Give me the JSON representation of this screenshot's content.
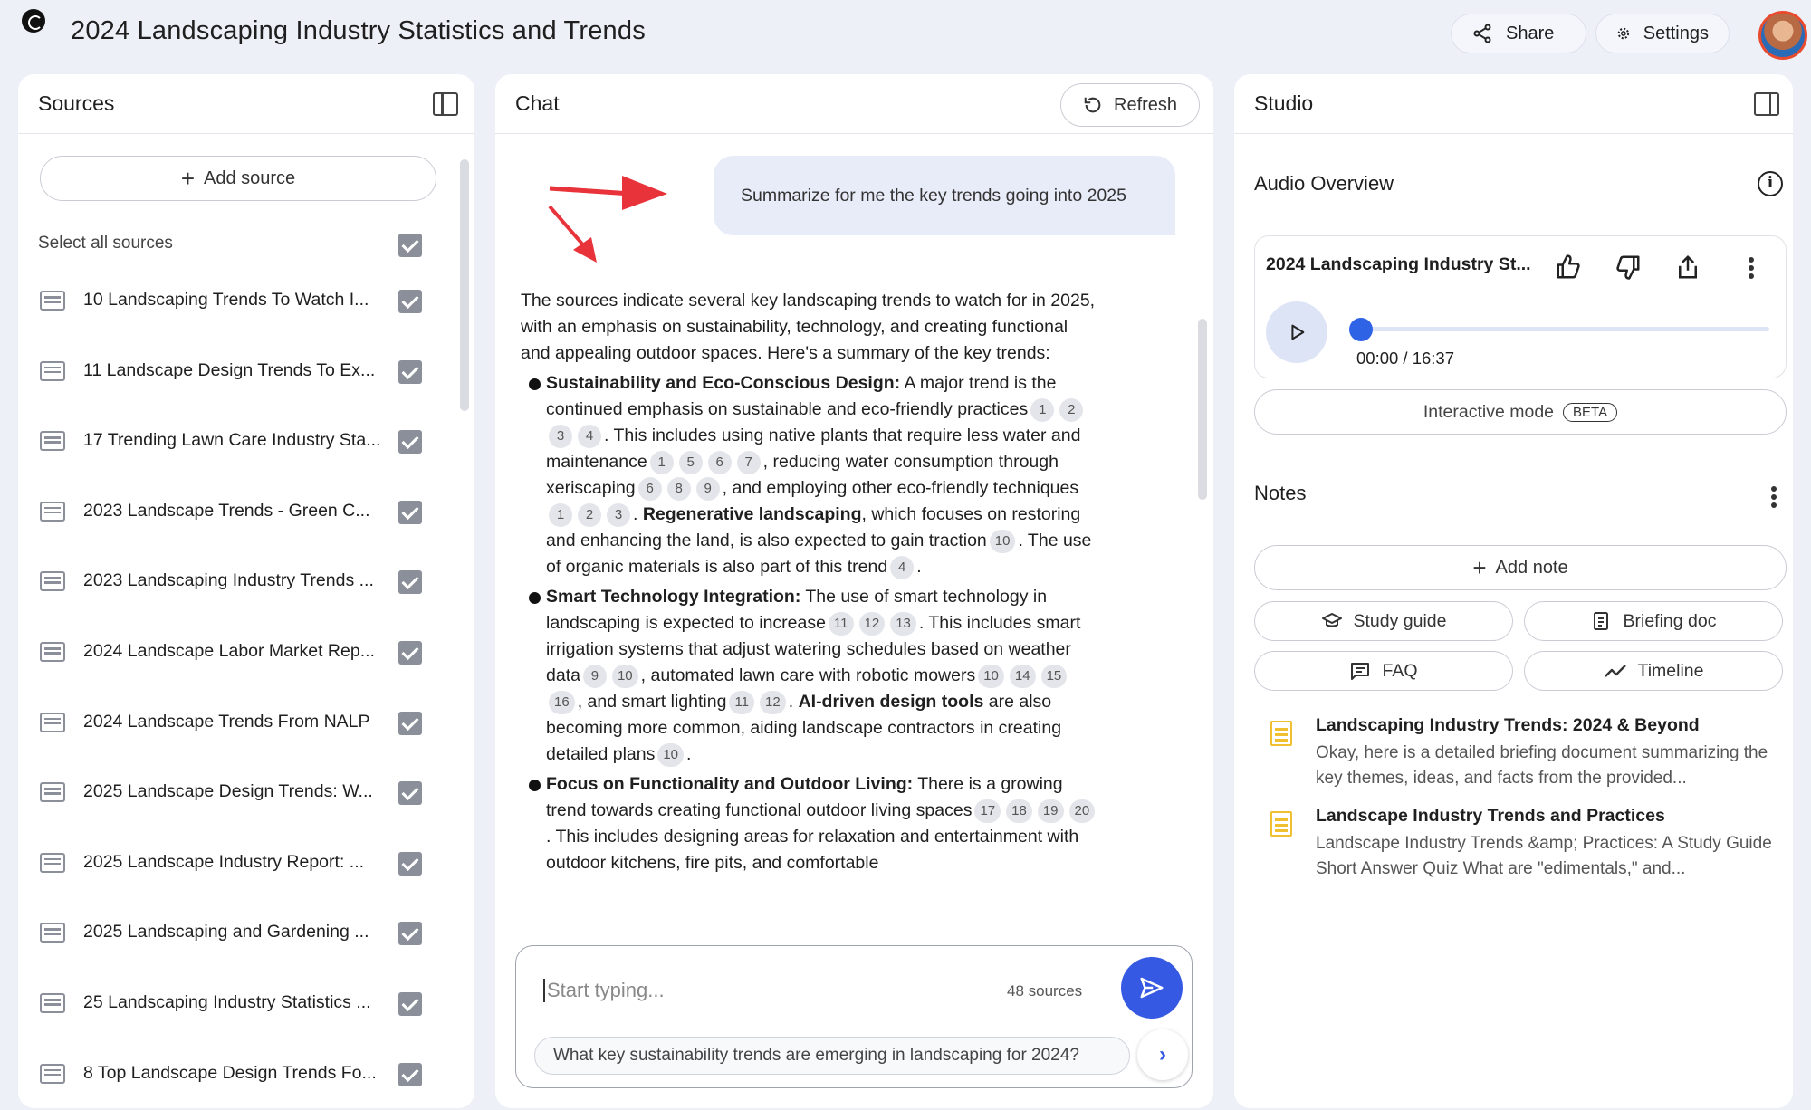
{
  "app": {
    "title": "2024 Landscaping Industry Statistics and Trends",
    "share_label": "Share",
    "settings_label": "Settings"
  },
  "sources": {
    "title": "Sources",
    "add_source_label": "Add source",
    "select_all_label": "Select all sources",
    "items": [
      {
        "label": "10 Landscaping Trends To Watch I...",
        "checked": true
      },
      {
        "label": "11 Landscape Design Trends To Ex...",
        "checked": true
      },
      {
        "label": "17 Trending Lawn Care Industry Sta...",
        "checked": true
      },
      {
        "label": "2023 Landscape Trends - Green C...",
        "checked": true
      },
      {
        "label": "2023 Landscaping Industry Trends ...",
        "checked": true
      },
      {
        "label": "2024 Landscape Labor Market Rep...",
        "checked": true
      },
      {
        "label": "2024 Landscape Trends From NALP",
        "checked": true
      },
      {
        "label": "2025 Landscape Design Trends: W...",
        "checked": true
      },
      {
        "label": "2025 Landscape Industry Report: ...",
        "checked": true
      },
      {
        "label": "2025 Landscaping and Gardening ...",
        "checked": true
      },
      {
        "label": "25 Landscaping Industry Statistics ...",
        "checked": true
      },
      {
        "label": "8 Top Landscape Design Trends Fo...",
        "checked": true
      }
    ]
  },
  "chat": {
    "title": "Chat",
    "refresh_label": "Refresh",
    "user_message": "Summarize for me the key trends going into 2025",
    "answer": {
      "intro": "The sources indicate several key landscaping trends to watch for in 2025, with an emphasis on sustainability, technology, and creating functional and appealing outdoor spaces. Here's a summary of the key trends:",
      "b1_title": "Sustainability and Eco-Conscious Design:",
      "b1_t1": " A major trend is the continued emphasis on sustainable and eco-friendly practices",
      "b1_t2": ". This includes using native plants that require less water and maintenance",
      "b1_t3": ", reducing water consumption through xeriscaping",
      "b1_t4": ", and employing other eco-friendly techniques",
      "b1_t5": ". ",
      "b1_bold2": "Regenerative landscaping",
      "b1_t6": ", which focuses on restoring and enhancing the land, is also expected to gain traction",
      "b1_t7": ". The use of organic materials is also part of this trend",
      "b1_t8": ".",
      "b2_title": "Smart Technology Integration:",
      "b2_t1": " The use of smart technology in landscaping is expected to increase",
      "b2_t2": ". This includes smart irrigation systems that adjust watering schedules based on weather data",
      "b2_t3": ", automated lawn care with robotic mowers",
      "b2_t4": ", and smart lighting",
      "b2_t5": ". ",
      "b2_bold2": "AI-driven design tools",
      "b2_t6": " are also becoming more common, aiding landscape contractors in creating detailed plans",
      "b2_t7": ".",
      "b3_title": "Focus on Functionality and Outdoor Living:",
      "b3_t1": " There is a growing trend towards creating functional outdoor living spaces",
      "b3_t2": ". This includes designing areas for relaxation and entertainment with outdoor kitchens, fire pits, and comfortable"
    },
    "input_placeholder": "Start typing...",
    "source_count": "48 sources",
    "suggestion": "What key sustainability trends are emerging in landscaping for 2024?"
  },
  "citations": {
    "b1_a": [
      "1"
    ],
    "b1_b": [
      "2",
      "3",
      "4"
    ],
    "b1_c": [
      "1",
      "5",
      "6",
      "7"
    ],
    "b1_d": [
      "6",
      "8",
      "9"
    ],
    "b1_e": [
      "1",
      "2",
      "3"
    ],
    "b1_f": [
      "10"
    ],
    "b1_g": [
      "4"
    ],
    "b2_a": [
      "11",
      "12",
      "13"
    ],
    "b2_b": [
      "9",
      "10"
    ],
    "b2_c": [
      "10",
      "14",
      "15",
      "16"
    ],
    "b2_d": [
      "11",
      "12"
    ],
    "b2_e": [
      "10"
    ],
    "b3_a": [
      "17",
      "18"
    ],
    "b3_b": [
      "19",
      "20"
    ]
  },
  "studio": {
    "title": "Studio",
    "audio_overview_title": "Audio Overview",
    "audio_card_title": "2024 Landscaping Industry St...",
    "audio_time": "00:00 / 16:37",
    "audio_progress": 0,
    "interactive_label": "Interactive mode",
    "beta_label": "BETA",
    "notes_title": "Notes",
    "add_note_label": "Add note",
    "study_guide_label": "Study guide",
    "briefing_doc_label": "Briefing doc",
    "faq_label": "FAQ",
    "timeline_label": "Timeline",
    "notes": [
      {
        "title": "Landscaping Industry Trends: 2024 & Beyond",
        "snippet": "Okay, here is a detailed briefing document summarizing the key themes, ideas, and facts from the provided..."
      },
      {
        "title": "Landscape Industry Trends and Practices",
        "snippet": "Landscape Industry Trends &amp; Practices: A Study Guide Short Answer Quiz What are \"edimentals,\" and..."
      }
    ]
  },
  "colors": {
    "accent": "#3659e3",
    "annotation_arrow": "#e8333a",
    "note_icon": "#f0c030"
  }
}
